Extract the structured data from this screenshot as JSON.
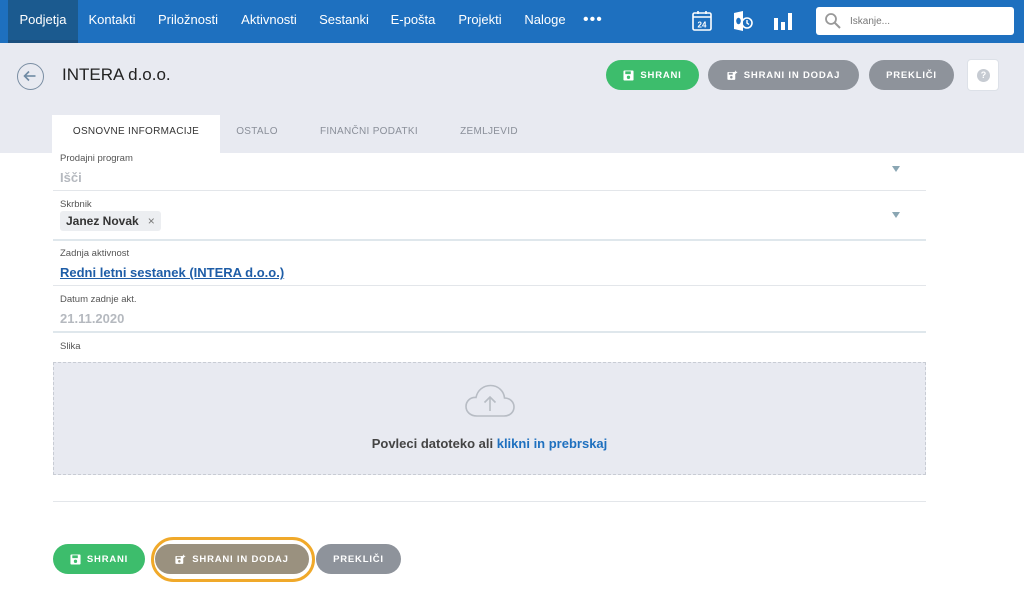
{
  "nav": {
    "items": [
      "Podjetja",
      "Kontakti",
      "Priložnosti",
      "Aktivnosti",
      "Sestanki",
      "E-pošta",
      "Projekti",
      "Naloge"
    ],
    "more": "•••",
    "calendar_day": "24",
    "search_placeholder": "Iskanje..."
  },
  "header": {
    "title": "INTERA d.o.o.",
    "save_label": "SHRANI",
    "save_add_label": "SHRANI IN DODAJ",
    "cancel_label": "PREKLIČI",
    "help_label": "?"
  },
  "tabs": [
    "OSNOVNE INFORMACIJE",
    "OSTALO",
    "FINANČNI PODATKI",
    "ZEMLJEVID"
  ],
  "form": {
    "prodajni_program": {
      "label": "Prodajni program",
      "value": "Išči"
    },
    "skrbnik": {
      "label": "Skrbnik",
      "chip": "Janez Novak",
      "chip_remove": "×"
    },
    "zadnja_aktivnost": {
      "label": "Zadnja aktivnost",
      "value": "Redni letni sestanek (INTERA d.o.o.)"
    },
    "datum": {
      "label": "Datum zadnje akt.",
      "value": "21.11.2020"
    },
    "slika": {
      "label": "Slika",
      "drop_text": "Povleci datoteko ali",
      "drop_link": "klikni in prebrskaj"
    }
  },
  "footer": {
    "save_label": "SHRANI",
    "save_add_label": "SHRANI IN DODAJ",
    "cancel_label": "PREKLIČI"
  },
  "colors": {
    "nav_bg": "#1e70bf",
    "header_bg": "#e8eaf1",
    "save_green": "#3dbd6c",
    "button_gray": "#8e939b",
    "focus_ring": "#f0a92a",
    "link": "#1e5da7"
  }
}
